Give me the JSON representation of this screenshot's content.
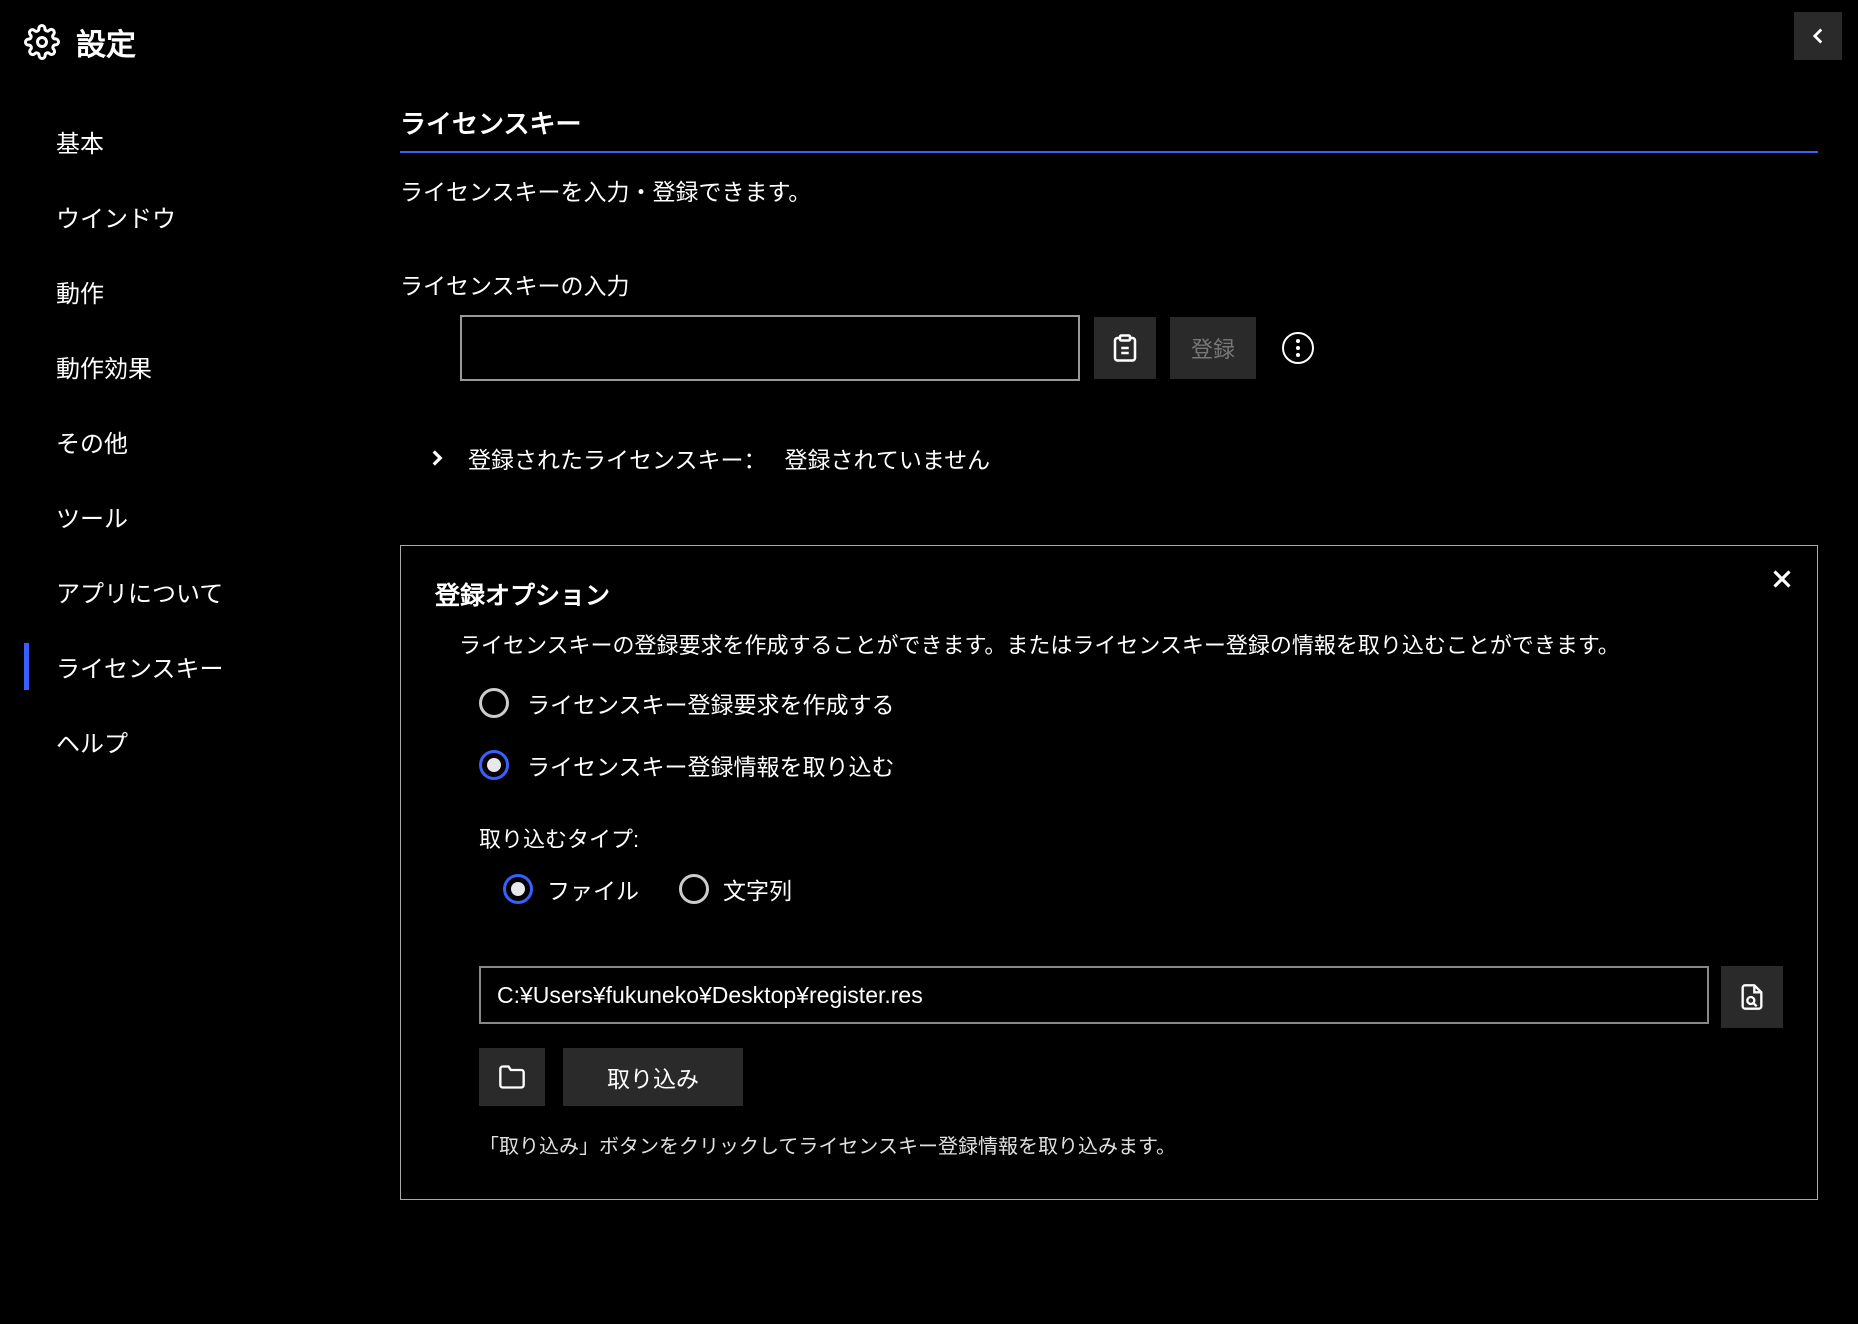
{
  "header": {
    "title": "設定"
  },
  "sidebar": {
    "items": [
      {
        "label": "基本"
      },
      {
        "label": "ウインドウ"
      },
      {
        "label": "動作"
      },
      {
        "label": "動作効果"
      },
      {
        "label": "その他"
      },
      {
        "label": "ツール"
      },
      {
        "label": "アプリについて"
      },
      {
        "label": "ライセンスキー"
      },
      {
        "label": "ヘルプ"
      }
    ],
    "activeIndex": 7
  },
  "main": {
    "section_title": "ライセンスキー",
    "section_desc": "ライセンスキーを入力・登録できます。",
    "input_label": "ライセンスキーの入力",
    "license_input_value": "",
    "register_button": "登録",
    "registered_label": "登録されたライセンスキー：",
    "registered_value": "登録されていません"
  },
  "panel": {
    "title": "登録オプション",
    "desc": "ライセンスキーの登録要求を作成することができます。またはライセンスキー登録の情報を取り込むことができます。",
    "option_create": "ライセンスキー登録要求を作成する",
    "option_import": "ライセンスキー登録情報を取り込む",
    "import_type_label": "取り込むタイプ:",
    "type_file": "ファイル",
    "type_string": "文字列",
    "file_path": "C:¥Users¥fukuneko¥Desktop¥register.res",
    "import_button": "取り込み",
    "hint": "「取り込み」ボタンをクリックしてライセンスキー登録情報を取り込みます。"
  }
}
